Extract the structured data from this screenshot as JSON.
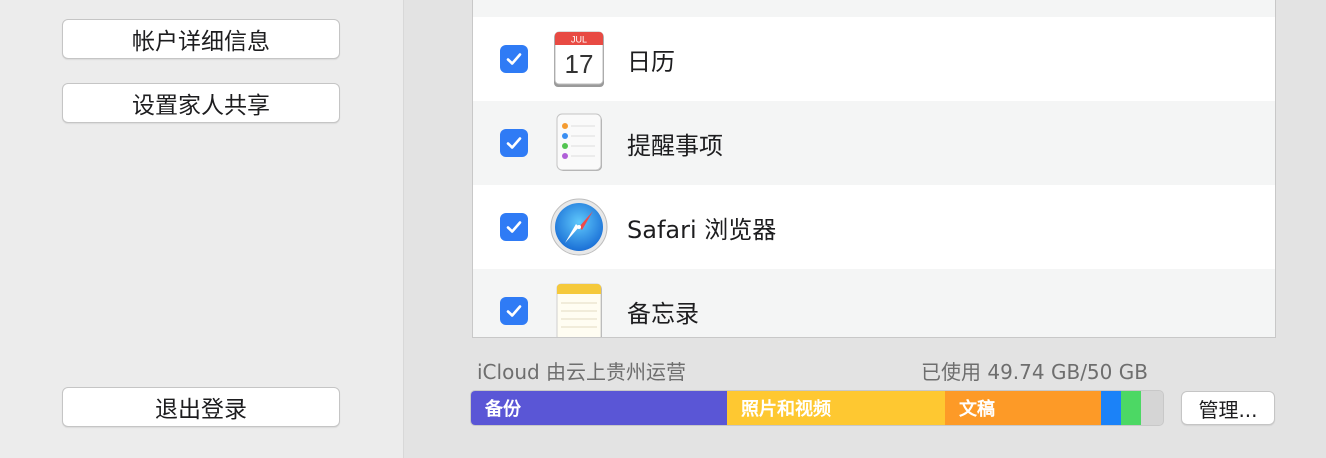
{
  "left": {
    "account_details_label": "帐户详细信息",
    "family_sharing_label": "设置家人共享",
    "sign_out_label": "退出登录"
  },
  "apps": [
    {
      "label": "日历",
      "checked": true,
      "icon": "calendar-icon",
      "calendar_month": "JUL",
      "calendar_day": "17"
    },
    {
      "label": "提醒事项",
      "checked": true,
      "icon": "reminders-icon"
    },
    {
      "label": "Safari 浏览器",
      "checked": true,
      "icon": "safari-icon"
    },
    {
      "label": "备忘录",
      "checked": true,
      "icon": "notes-icon"
    }
  ],
  "storage": {
    "operator_text": "iCloud 由云上贵州运营",
    "used_text": "已使用 49.74 GB/50 GB",
    "segments": [
      {
        "label": "备份",
        "color": "#5a56d6"
      },
      {
        "label": "照片和视频",
        "color": "#fec831"
      },
      {
        "label": "文稿",
        "color": "#fd9a27"
      },
      {
        "label": "",
        "color": "#1b82f8"
      },
      {
        "label": "",
        "color": "#4cd864"
      },
      {
        "label": "",
        "color": "#d5d5d5"
      }
    ],
    "manage_label": "管理..."
  },
  "colors": {
    "checkbox": "#2f7bf5",
    "calendar_red": "#e84a43"
  }
}
